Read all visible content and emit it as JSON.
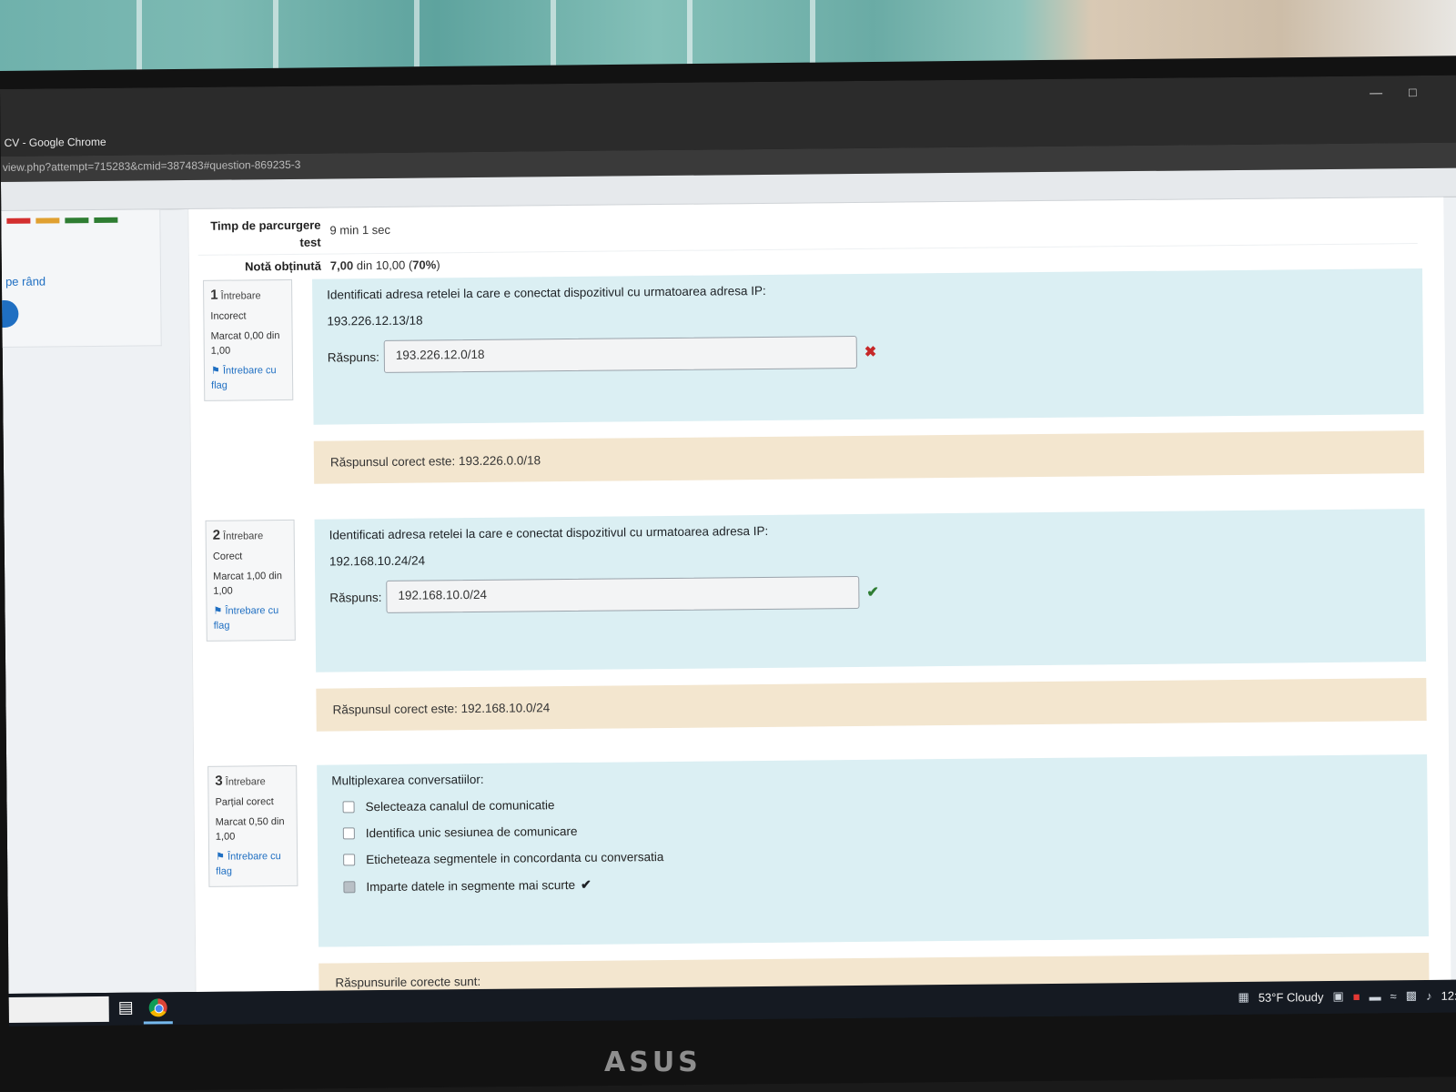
{
  "window": {
    "title": "CV - Google Chrome",
    "url": "view.php?attempt=715283&cmid=387483#question-869235-3",
    "minimize_icon": "minimize-icon",
    "maximize_icon": "maximize-icon"
  },
  "drawer": {
    "link": "pe rând",
    "nav_colors": [
      "#d32f2f",
      "#e0a030",
      "#2e7d32",
      "#2e7d32"
    ]
  },
  "summary": {
    "time_label": "Timp de parcurgere test",
    "time_value": "9 min 1 sec",
    "grade_label": "Notă obținută",
    "grade_value_bold": "7,00",
    "grade_value_rest": "din 10,00 (",
    "grade_percent": "70%",
    "grade_close": ")"
  },
  "questions": [
    {
      "number": "1",
      "label": "Întrebare",
      "state": "Incorect",
      "mark": "Marcat 0,00 din 1,00",
      "flag": "Întrebare cu flag",
      "text": "Identificati adresa retelei la care e conectat dispozitivul cu urmatoarea adresa IP:",
      "ip": "193.226.12.13/18",
      "answer_label": "Răspuns:",
      "answer": "193.226.12.0/18",
      "result_icon": "incorrect-icon",
      "feedback": "Răspunsul corect este: 193.226.0.0/18"
    },
    {
      "number": "2",
      "label": "Întrebare",
      "state": "Corect",
      "mark": "Marcat 1,00 din 1,00",
      "flag": "Întrebare cu flag",
      "text": "Identificati adresa retelei la care e conectat dispozitivul cu urmatoarea adresa IP:",
      "ip": "192.168.10.24/24",
      "answer_label": "Răspuns:",
      "answer": "192.168.10.0/24",
      "result_icon": "correct-icon",
      "feedback": "Răspunsul corect este: 192.168.10.0/24"
    },
    {
      "number": "3",
      "label": "Întrebare",
      "state": "Parțial corect",
      "mark": "Marcat 0,50 din 1,00",
      "flag": "Întrebare cu flag",
      "text": "Multiplexarea conversatiilor:",
      "options": [
        {
          "text": "Selecteaza canalul de comunicatie",
          "checked": false
        },
        {
          "text": "Identifica unic sesiunea de comunicare",
          "checked": false
        },
        {
          "text": "Eticheteaza segmentele in concordanta cu conversatia",
          "checked": false
        },
        {
          "text": "Imparte datele in segmente mai scurte",
          "checked": true
        }
      ],
      "feedback": "Răspunsurile corecte sunt:"
    }
  ],
  "taskbar": {
    "weather": "53°F  Cloudy",
    "clock": "12:"
  },
  "brand": "ASUS"
}
